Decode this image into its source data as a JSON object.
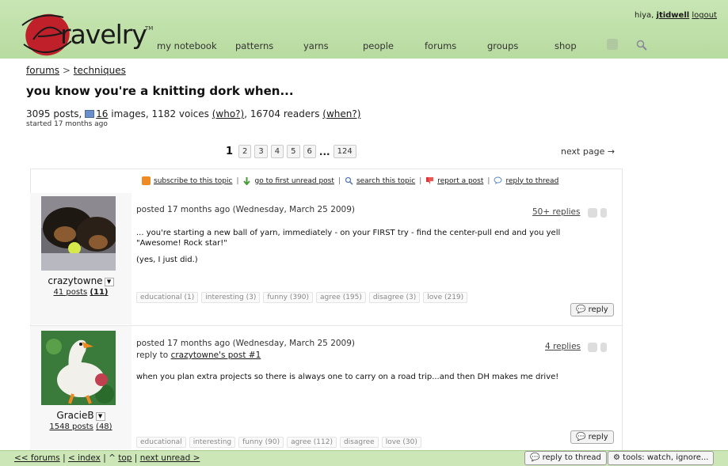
{
  "header": {
    "logo_text": "ravelry",
    "logo_tm": "TM",
    "greeting": "hiya,",
    "username": "jtidwell",
    "logout": "logout",
    "nav": [
      "my notebook",
      "patterns",
      "yarns",
      "people",
      "forums",
      "groups",
      "shop"
    ],
    "nav_icons": [
      "inbox-icon",
      "search-icon"
    ]
  },
  "breadcrumb": {
    "root": "forums",
    "sep": ">",
    "current": "techniques"
  },
  "topic": {
    "title": "you know you're a knitting dork when...",
    "posts_count": "3095 posts,",
    "images_count": "16",
    "images_label": "images, 1182 voices",
    "who": "(who?)",
    "readers": ", 16704 readers",
    "when": "(when?)",
    "started": "started 17 months ago"
  },
  "pager": {
    "current": "1",
    "pages": [
      "2",
      "3",
      "4",
      "5",
      "6"
    ],
    "ellipsis": "...",
    "last": "124",
    "next": "next page →"
  },
  "toolbar": {
    "subscribe": "subscribe to this topic",
    "first_unread": "go to first unread post",
    "search": "search this topic",
    "report": "report a post",
    "reply": "reply to thread",
    "sep": "|"
  },
  "posts": [
    {
      "username": "crazytowne",
      "user_posts": "41 posts",
      "user_count": "(11)",
      "meta": "posted 17 months ago (Wednesday, March 25 2009)",
      "replies": "50+ replies",
      "body1": "... you're starting a new ball of yarn, immediately - on your FIRST try - find the center-pull end and you yell \"Awesome! Rock star!\"",
      "body2": "(yes, I just did.)",
      "tags": [
        "educational (1)",
        "interesting (3)",
        "funny (390)",
        "agree (195)",
        "disagree (3)",
        "love (219)"
      ],
      "reply": "reply"
    },
    {
      "username": "GracieB",
      "user_posts": "1548 posts",
      "user_count": "(48)",
      "meta": "posted 17 months ago (Wednesday, March 25 2009)",
      "reply_to_prefix": "reply to",
      "reply_to_link": "crazytowne's post #1",
      "replies": "4 replies",
      "body1": "when you plan extra projects so there is always one to carry on a road trip...and then DH makes me drive!",
      "tags": [
        "educational",
        "interesting",
        "funny (90)",
        "agree (112)",
        "disagree",
        "love (30)"
      ],
      "reply": "reply"
    }
  ],
  "footer": {
    "forums": "<< forums",
    "index": "< index",
    "top_caret": "^",
    "top": "top",
    "next_unread": "next unread >",
    "sep": "|",
    "reply_thread": "reply to thread",
    "tools": "tools: watch, ignore..."
  },
  "colors": {
    "header_green": "#c8e6b4",
    "logo_red": "#c0202a",
    "footer_green": "#cde6b8"
  }
}
